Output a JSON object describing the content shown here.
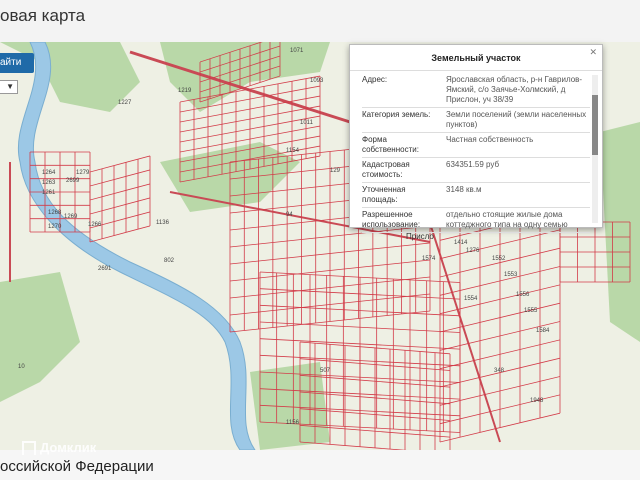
{
  "header": {
    "title": "овая карта"
  },
  "controls": {
    "find_button": "айти"
  },
  "map": {
    "labels": [
      "1071",
      "1093",
      "1227",
      "1219",
      "1011",
      "1154",
      "1264",
      "1263",
      "1261",
      "2699",
      "1268",
      "1270",
      "1269",
      "1279",
      "1266",
      "802",
      "2691",
      "1136",
      "1554",
      "1552",
      "1553",
      "1556",
      "1555",
      "1584",
      "1948",
      "348",
      "1156",
      "10",
      "1414",
      "1276",
      "1574",
      "507",
      "94",
      "129"
    ],
    "place_label": "Присло"
  },
  "popup": {
    "title": "Земельный участок",
    "rows": [
      {
        "key": "Адрес:",
        "value": "Ярославская область, р-н Гаврилов-Ямский, с/о Заячье-Холмский, д Прислон, уч 38/39"
      },
      {
        "key": "Категория земель:",
        "value": "Земли поселений (земли населенных пунктов)"
      },
      {
        "key": "Форма собственности:",
        "value": "Частная собственность"
      },
      {
        "key": "Кадастровая стоимость:",
        "value": "634351.59 руб"
      },
      {
        "key": "Уточненная площадь:",
        "value": "3148 кв.м"
      },
      {
        "key": "Разрешенное использование:",
        "value": "отдельно стоящие жилые дома коттеджного типа на одну семью"
      }
    ]
  },
  "watermark": {
    "text": "Домклик"
  },
  "footer": {
    "title": "оссийской Федерации"
  },
  "colors": {
    "parcel_line": "#d23b48",
    "forest": "#b9d8a8",
    "river": "#9cc8e6",
    "road": "#e3b3b3"
  }
}
